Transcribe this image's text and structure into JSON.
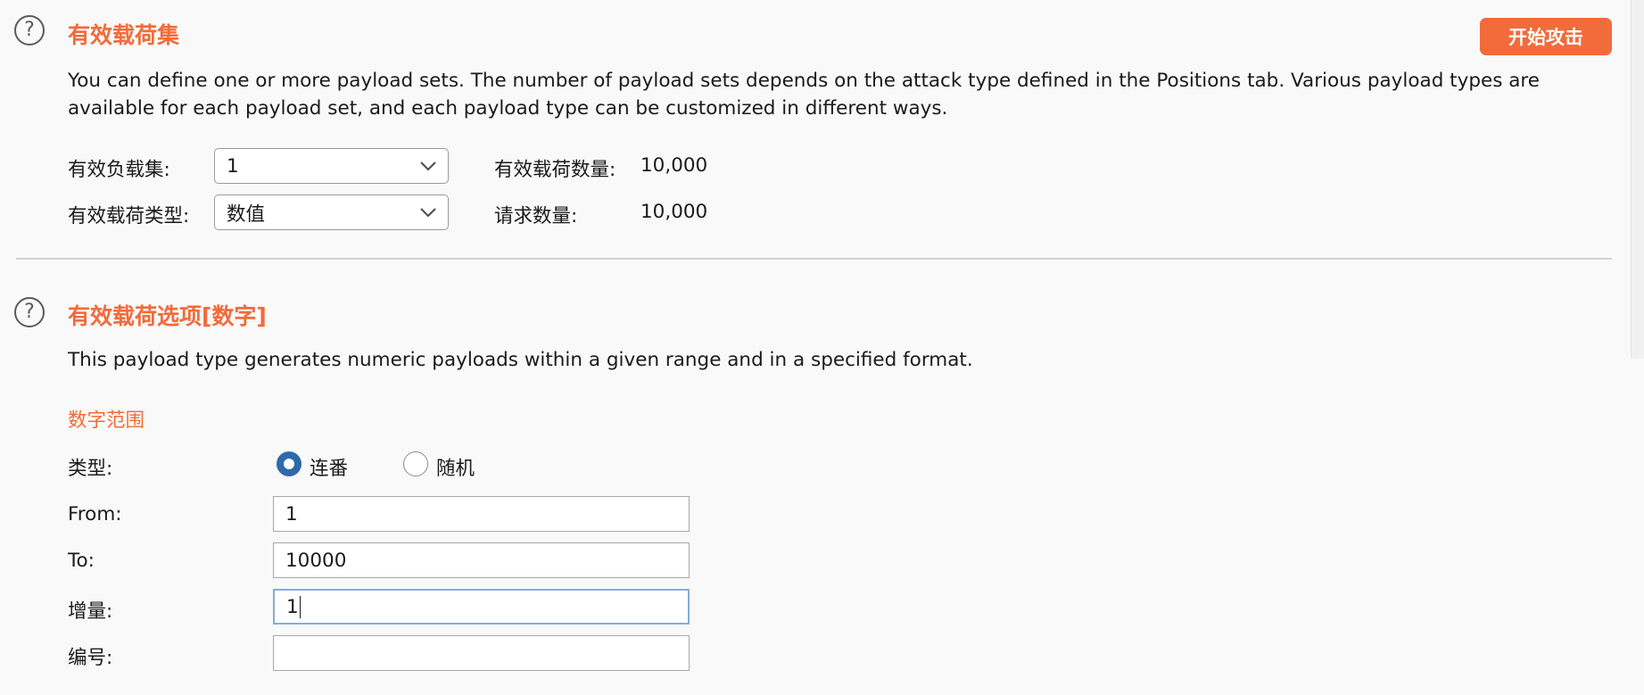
{
  "payload_sets_section": {
    "title": "有效载荷集",
    "help_icon": "question-circle-icon",
    "description": "You can define one or more payload sets. The number of payload sets depends on the attack type defined in the Positions tab. Various payload types are available for each payload set, and each payload type can be customized in different ways.",
    "start_attack_label": "开始攻击",
    "payload_set_label": "有效负载集:",
    "payload_set_value": "1",
    "payload_type_label": "有效载荷类型:",
    "payload_type_value": "数值",
    "payload_count_label": "有效载荷数量:",
    "payload_count_value": "10,000",
    "request_count_label": "请求数量:",
    "request_count_value": "10,000"
  },
  "payload_options_section": {
    "title": "有效载荷选项[数字]",
    "help_icon": "question-circle-icon",
    "description": "This payload type generates numeric payloads within a given range and in a specified format.",
    "number_range_title": "数字范围",
    "type_label": "类型:",
    "radio_sequential_label": "连番",
    "radio_random_label": "随机",
    "selected_type": "sequential",
    "from_label": "From:",
    "from_value": "1",
    "to_label": "To:",
    "to_value": "10000",
    "step_label": "增量:",
    "step_value": "1",
    "number_label": "编号:",
    "number_value": ""
  },
  "colors": {
    "accent": "#f26b3a",
    "radio_checked": "#2f6aa8",
    "focus_border": "#86acd8",
    "background": "#f9f9f9"
  }
}
